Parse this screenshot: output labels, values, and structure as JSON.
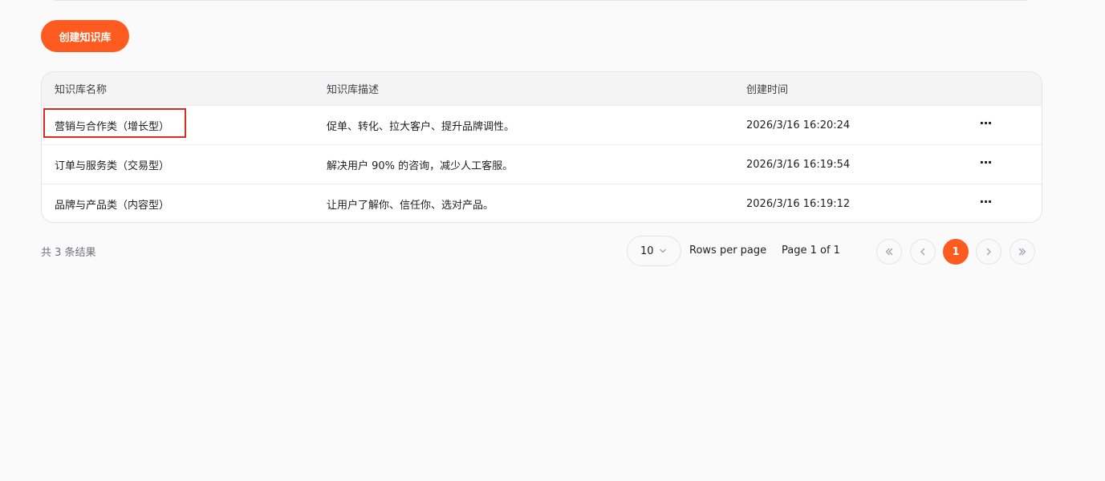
{
  "toolbar": {
    "create_label": "创建知识库"
  },
  "table": {
    "columns": [
      "知识库名称",
      "知识库描述",
      "创建时间"
    ],
    "rows": [
      {
        "name": "营销与合作类（增长型）",
        "description": "促单、转化、拉大客户、提升品牌调性。",
        "created": "2026/3/16 16:20:24",
        "more": "···"
      },
      {
        "name": "订单与服务类（交易型）",
        "description": "解决用户 90% 的咨询，减少人工客服。",
        "created": "2026/3/16 16:19:54",
        "more": "···"
      },
      {
        "name": "品牌与产品类（内容型）",
        "description": "让用户了解你、信任你、选对产品。",
        "created": "2026/3/16 16:19:12",
        "more": "···"
      }
    ]
  },
  "pagination": {
    "result_count": "共 3 条结果",
    "rows_per_page_value": "10",
    "rows_per_page_label": "Rows per page",
    "page_info": "Page 1 of 1",
    "current_page": "1"
  },
  "colors": {
    "accent": "#ff5a1f",
    "highlight": "#d92b22"
  },
  "icons": {
    "first": "chevrons-left-icon",
    "prev": "chevron-left-icon",
    "next": "chevron-right-icon",
    "last": "chevrons-right-icon",
    "select": "chevron-down-icon",
    "more": "more-horizontal-icon"
  }
}
